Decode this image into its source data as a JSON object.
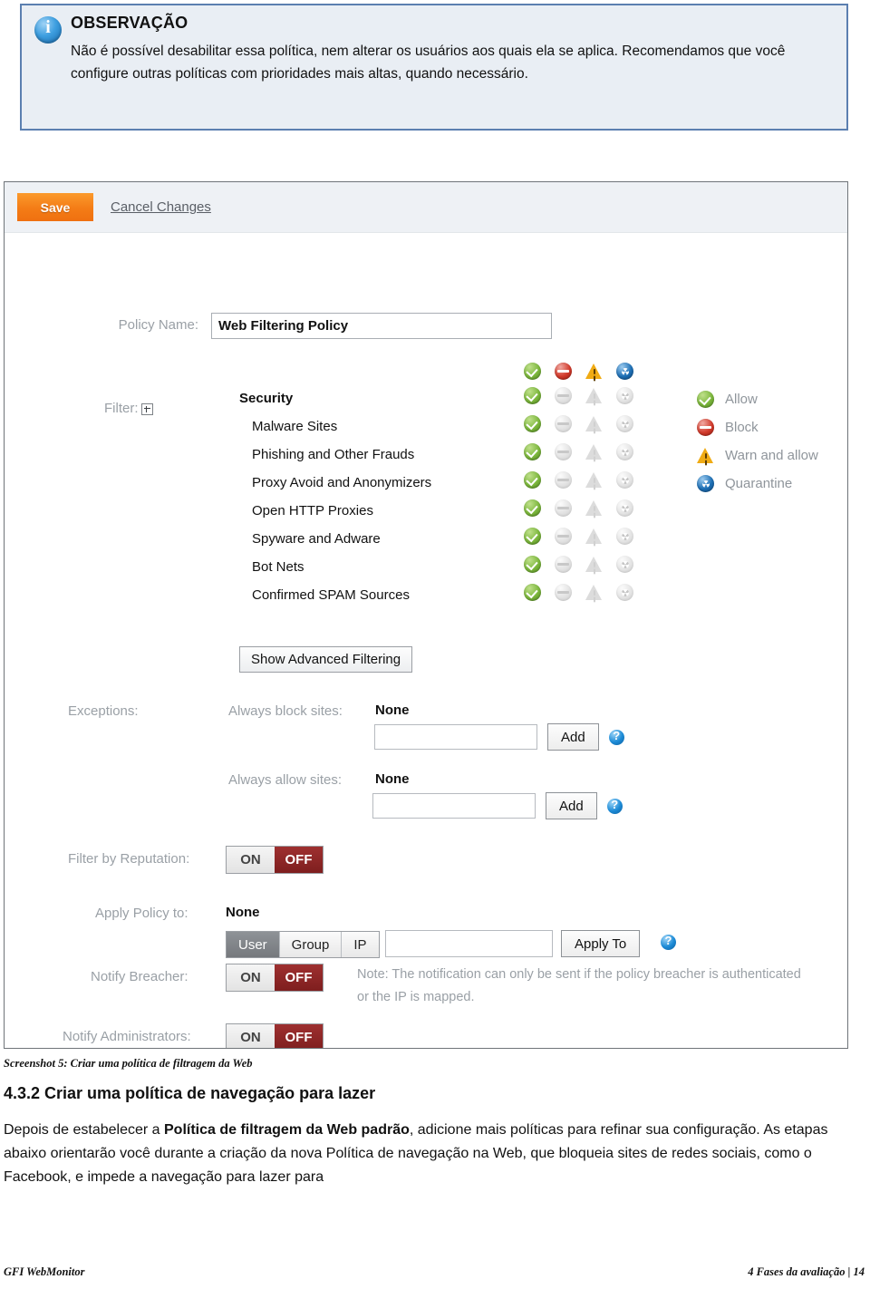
{
  "note": {
    "icon": "info-icon",
    "title": "OBSERVAÇÃO",
    "text": "Não é possível desabilitar essa política, nem alterar os usuários aos quais ela se aplica. Recomendamos que você configure outras políticas com prioridades mais altas, quando necessário."
  },
  "screenshot": {
    "toolbar": {
      "save_label": "Save",
      "cancel_label": "Cancel Changes"
    },
    "policy_name": {
      "label": "Policy Name:",
      "value": "Web Filtering Policy"
    },
    "filter": {
      "label": "Filter:",
      "expander_icon": "expand-plus-icon",
      "column_icons": [
        "allow-icon",
        "block-icon",
        "warn-icon",
        "quarantine-icon"
      ],
      "root": "Security",
      "categories": [
        "Malware Sites",
        "Phishing and Other Frauds",
        "Proxy Avoid and Anonymizers",
        "Open HTTP Proxies",
        "Spyware and Adware",
        "Bot Nets",
        "Confirmed SPAM Sources"
      ]
    },
    "legend": [
      {
        "icon": "allow-icon",
        "label": "Allow"
      },
      {
        "icon": "block-icon",
        "label": "Block"
      },
      {
        "icon": "warn-icon",
        "label": "Warn and allow"
      },
      {
        "icon": "quarantine-icon",
        "label": "Quarantine"
      }
    ],
    "advanced_button": "Show Advanced Filtering",
    "exceptions": {
      "label": "Exceptions:",
      "block": {
        "label": "Always block sites:",
        "value": "None",
        "input_value": "",
        "add_label": "Add",
        "help_icon": "help-icon"
      },
      "allow": {
        "label": "Always allow sites:",
        "value": "None",
        "input_value": "",
        "add_label": "Add",
        "help_icon": "help-icon"
      }
    },
    "reputation": {
      "label": "Filter by Reputation:",
      "on_label": "ON",
      "off_label": "OFF",
      "state": "OFF"
    },
    "apply_policy": {
      "label": "Apply Policy to:",
      "value": "None",
      "segments": [
        "User",
        "Group",
        "IP"
      ],
      "selected_segment": "User",
      "input_value": "",
      "button_label": "Apply To",
      "help_icon": "help-icon"
    },
    "notify_breacher": {
      "label": "Notify Breacher:",
      "on_label": "ON",
      "off_label": "OFF",
      "state": "OFF",
      "note": "Note: The notification can only be sent if the policy breacher is authenticated or the IP is mapped."
    },
    "notify_admins": {
      "label": "Notify Administrators:",
      "on_label": "ON",
      "off_label": "OFF",
      "state": "OFF"
    }
  },
  "document": {
    "caption": "Screenshot 5: Criar uma política de filtragem da Web",
    "heading": "4.3.2 Criar uma política de navegação para lazer",
    "paragraph_1": "Depois de estabelecer a ",
    "paragraph_bold": "Política de filtragem da Web padrão",
    "paragraph_2": ", adicione mais políticas para refinar sua configuração. As etapas abaixo orientarão você durante a criação da nova Política de navegação na Web, que bloqueia sites de redes sociais, como o Facebook, e impede a navegação para lazer para",
    "footer_left": "GFI WebMonitor",
    "footer_right": "4 Fases da avaliação | 14"
  }
}
